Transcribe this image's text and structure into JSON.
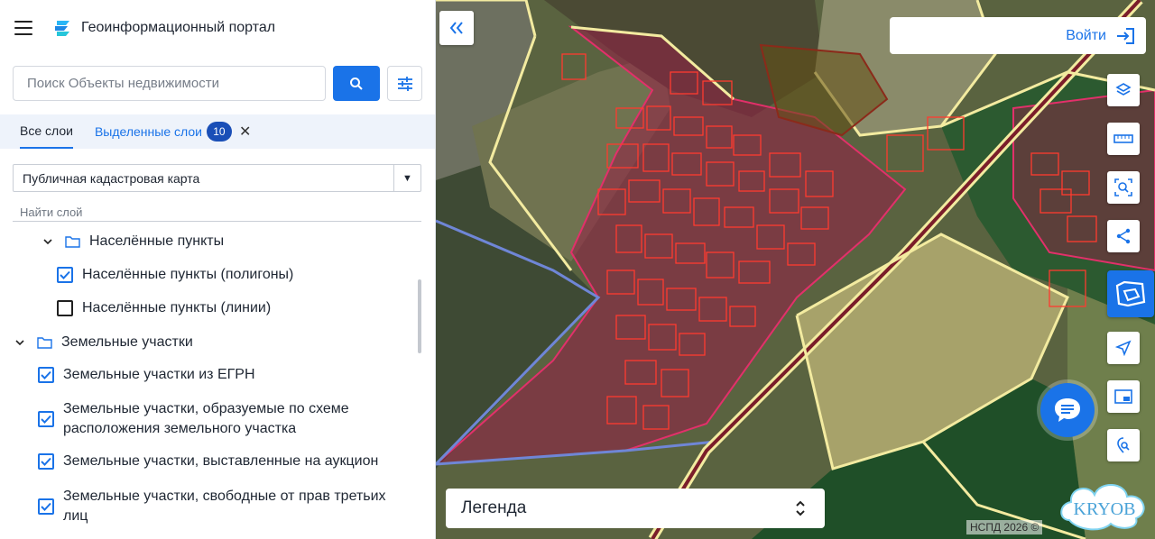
{
  "app": {
    "title": "Геоинформационный портал"
  },
  "search": {
    "placeholder": "Поиск Объекты недвижимости"
  },
  "tabs": {
    "all": "Все слои",
    "selected": "Выделенные слои",
    "selected_count": "10"
  },
  "basemap_select": {
    "value": "Публичная кадастровая карта"
  },
  "find_layer": {
    "placeholder": "Найти слой"
  },
  "tree": [
    {
      "label": "Населённые пункты",
      "type": "folder",
      "expanded": true
    },
    {
      "label": "Населённые пункты (полигоны)",
      "type": "layer",
      "checked": true
    },
    {
      "label": "Населённые пункты (линии)",
      "type": "layer",
      "checked": false
    },
    {
      "label": "Земельные участки",
      "type": "folder",
      "expanded": true
    },
    {
      "label": "Земельные участки из ЕГРН",
      "type": "layer",
      "checked": true
    },
    {
      "label": "Земельные участки, образуемые по схеме расположения земельного участка",
      "type": "layer",
      "checked": true
    },
    {
      "label": "Земельные участки, выставленные на аукцион",
      "type": "layer",
      "checked": true
    },
    {
      "label": "Земельные участки, свободные от прав третьих лиц",
      "type": "layer",
      "checked": true
    }
  ],
  "map": {
    "login_label": "Войти",
    "legend_label": "Легенда",
    "copyright": "НСПД 2026 ©",
    "watermark": "KRYOB",
    "tools": [
      "layers-icon",
      "ruler-icon",
      "search-area-icon",
      "share-icon",
      "cadastre-icon",
      "locate-icon",
      "picture-in-picture-icon",
      "pin-search-icon"
    ]
  },
  "colors": {
    "accent": "#1a73e8",
    "parcel_outline": "#ff3b2f",
    "settlement_fill": "#a0204a",
    "boundary_yellow": "#f3eba0",
    "boundary_blue": "#6f86d6"
  }
}
